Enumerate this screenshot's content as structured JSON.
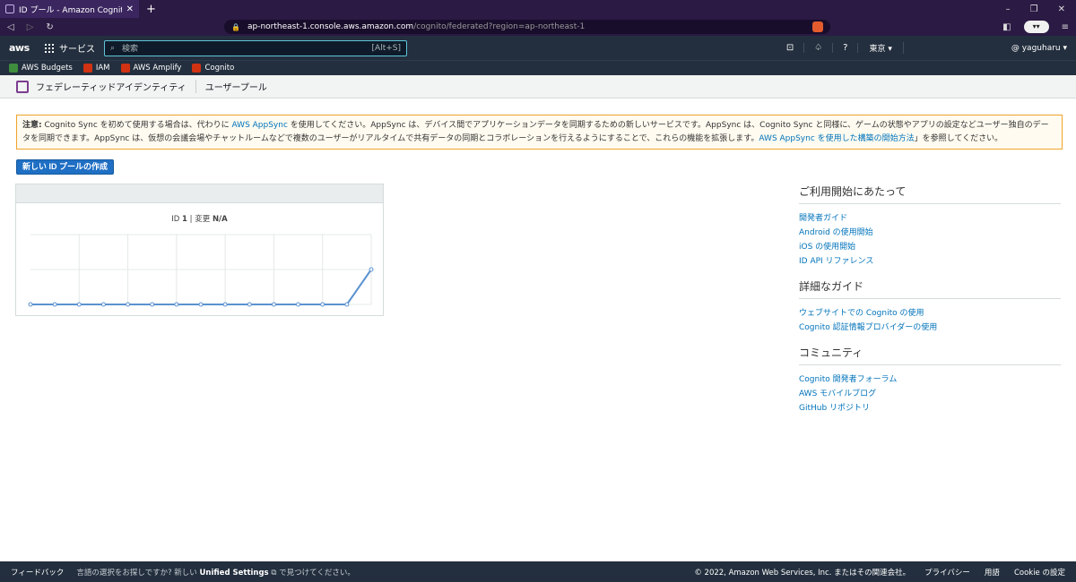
{
  "browser": {
    "tab_title": "ID プール - Amazon Cognito - アマゾ",
    "url_host": "ap-northeast-1.console.aws.amazon.com",
    "url_path": "/cognito/federated?region=ap-northeast-1"
  },
  "nav": {
    "logo": "aws",
    "services": "サービス",
    "search_placeholder": "検索",
    "search_shortcut": "[Alt+S]",
    "region": "東京 ▾",
    "user": "@ yaguharu ▾"
  },
  "bookmarks": [
    {
      "label": "AWS Budgets",
      "color": "#3e8e3e"
    },
    {
      "label": "IAM",
      "color": "#d13212"
    },
    {
      "label": "AWS Amplify",
      "color": "#d13212"
    },
    {
      "label": "Cognito",
      "color": "#d13212"
    }
  ],
  "subnav": {
    "federated": "フェデレーティッドアイデンティティ",
    "userpool": "ユーザープール"
  },
  "notice": {
    "label": "注意:",
    "text1": " Cognito Sync を初めて使用する場合は、代わりに ",
    "link1": "AWS AppSync",
    "text2": " を使用してください。AppSync は、デバイス間でアプリケーションデータを同期するための新しいサービスです。AppSync は、Cognito Sync と同様に、ゲームの状態やアプリの設定などユーザー独自のデータを同期できます。AppSync は、仮想の会議会場やチャットルームなどで複数のユーザーがリアルタイムで共有データの同期とコラボレーションを行えるようにすることで、これらの機能を拡張します。",
    "link2": "AWS AppSync を使用した構築の開始方法",
    "text3": "」を参照してください。"
  },
  "create_button": "新しい ID プールの作成",
  "pool": {
    "id_label": "ID",
    "id_value": "1",
    "sep": " | ",
    "change_label": "変更",
    "change_value": "N/A"
  },
  "chart_data": {
    "type": "line",
    "title": "",
    "xlabel": "",
    "ylabel": "",
    "series": [
      {
        "values": [
          0,
          0,
          0,
          0,
          0,
          0,
          0,
          0,
          0,
          0,
          0,
          0,
          0,
          0,
          1
        ]
      }
    ],
    "ylim": [
      0,
      2
    ],
    "grid": true
  },
  "sidebar": {
    "getting_started": {
      "title": "ご利用開始にあたって",
      "links": [
        "開発者ガイド",
        "Android の使用開始",
        "iOS の使用開始",
        "ID API リファレンス"
      ]
    },
    "detailed": {
      "title": "詳細なガイド",
      "links": [
        "ウェブサイトでの Cognito の使用",
        "Cognito 認証情報プロバイダーの使用"
      ]
    },
    "community": {
      "title": "コミュニティ",
      "links": [
        "Cognito 開発者フォーラム",
        "AWS モバイルブログ",
        "GitHub リポジトリ"
      ]
    }
  },
  "footer": {
    "feedback": "フィードバック",
    "msg1": "言語の選択をお探しですか? 新しい ",
    "msg_bold": "Unified Settings",
    "msg2": " で見つけてください。",
    "copyright": "© 2022, Amazon Web Services, Inc. またはその関連会社。",
    "privacy": "プライバシー",
    "terms": "用語",
    "cookie": "Cookie の設定"
  }
}
